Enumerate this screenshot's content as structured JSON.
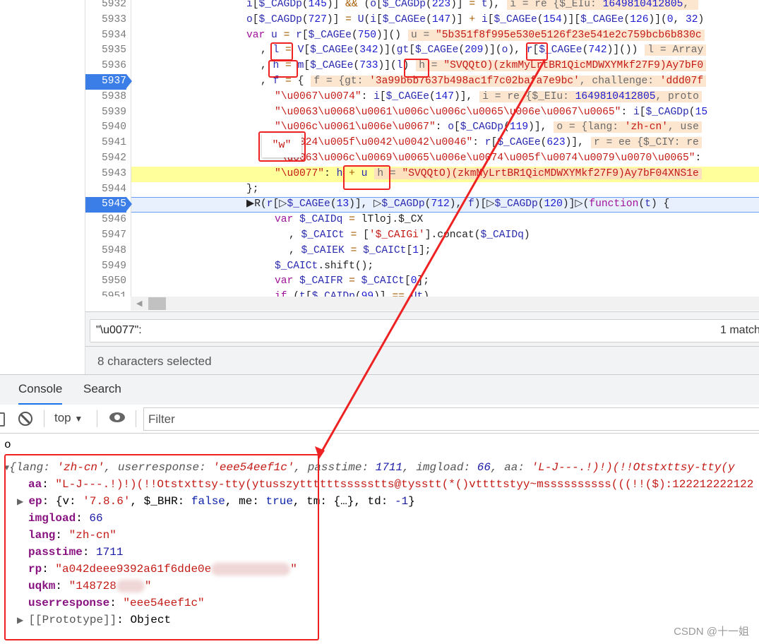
{
  "editor": {
    "lines": [
      {
        "num": "5932",
        "indent": 0,
        "tokens": [
          [
            "n",
            "i"
          ],
          [
            "p",
            "["
          ],
          [
            "n",
            "$_CAGDp"
          ],
          [
            "p",
            "("
          ],
          [
            "num",
            "145"
          ],
          [
            "p",
            ")] "
          ],
          [
            "o",
            "&&"
          ],
          [
            "p",
            " ("
          ],
          [
            "n",
            "o"
          ],
          [
            "p",
            "["
          ],
          [
            "n",
            "$_CAGDp"
          ],
          [
            "p",
            "("
          ],
          [
            "num",
            "223"
          ],
          [
            "p",
            ")] "
          ],
          [
            "o",
            "="
          ],
          [
            "p",
            " "
          ],
          [
            "n",
            "t"
          ],
          [
            "p",
            "),"
          ]
        ],
        "inline": [
          [
            "g",
            "i = re {$_EIu: "
          ],
          [
            "num",
            "1649810412805"
          ],
          [
            "g",
            ", "
          ]
        ]
      },
      {
        "num": "5933",
        "indent": 0,
        "tokens": [
          [
            "n",
            "o"
          ],
          [
            "p",
            "["
          ],
          [
            "n",
            "$_CAGDp"
          ],
          [
            "p",
            "("
          ],
          [
            "num",
            "727"
          ],
          [
            "p",
            ")] "
          ],
          [
            "o",
            "="
          ],
          [
            "p",
            " "
          ],
          [
            "n",
            "U"
          ],
          [
            "p",
            "("
          ],
          [
            "n",
            "i"
          ],
          [
            "p",
            "["
          ],
          [
            "n",
            "$_CAGEe"
          ],
          [
            "p",
            "("
          ],
          [
            "num",
            "147"
          ],
          [
            "p",
            ")] "
          ],
          [
            "o",
            "+"
          ],
          [
            "p",
            " "
          ],
          [
            "n",
            "i"
          ],
          [
            "p",
            "["
          ],
          [
            "n",
            "$_CAGEe"
          ],
          [
            "p",
            "("
          ],
          [
            "num",
            "154"
          ],
          [
            "p",
            ")]["
          ],
          [
            "n",
            "$_CAGEe"
          ],
          [
            "p",
            "("
          ],
          [
            "num",
            "126"
          ],
          [
            "p",
            ")]("
          ],
          [
            "num",
            "0"
          ],
          [
            "p",
            ", "
          ],
          [
            "num",
            "32"
          ],
          [
            "p",
            ")"
          ]
        ]
      },
      {
        "num": "5934",
        "indent": 0,
        "tokens": [
          [
            "k",
            "var "
          ],
          [
            "n",
            "u"
          ],
          [
            "p",
            " "
          ],
          [
            "o",
            "="
          ],
          [
            "p",
            " "
          ],
          [
            "n",
            "r"
          ],
          [
            "p",
            "["
          ],
          [
            "n",
            "$_CAGEe"
          ],
          [
            "p",
            "("
          ],
          [
            "num",
            "750"
          ],
          [
            "p",
            ")]()"
          ]
        ],
        "inline": [
          [
            "g",
            "u = "
          ],
          [
            "s",
            "\"5b351f8f995e530e5126f23e541e2c759bcb6b830c"
          ]
        ]
      },
      {
        "num": "5935",
        "indent": 1,
        "tokens": [
          [
            "p",
            ", "
          ],
          [
            "n",
            "l"
          ],
          [
            "p",
            " "
          ],
          [
            "o",
            "="
          ],
          [
            "p",
            " "
          ],
          [
            "n",
            "V"
          ],
          [
            "p",
            "["
          ],
          [
            "n",
            "$_CAGEe"
          ],
          [
            "p",
            "("
          ],
          [
            "num",
            "342"
          ],
          [
            "p",
            ")]("
          ],
          [
            "n",
            "gt"
          ],
          [
            "p",
            "["
          ],
          [
            "n",
            "$_CAGEe"
          ],
          [
            "p",
            "("
          ],
          [
            "num",
            "209"
          ],
          [
            "p",
            ")]("
          ],
          [
            "n",
            "o"
          ],
          [
            "p",
            "), "
          ],
          [
            "n",
            "r"
          ],
          [
            "p",
            "["
          ],
          [
            "n",
            "$_CAGEe"
          ],
          [
            "p",
            "("
          ],
          [
            "num",
            "742"
          ],
          [
            "p",
            ")]())"
          ]
        ],
        "inline": [
          [
            "g",
            "l = Array"
          ]
        ]
      },
      {
        "num": "5936",
        "indent": 1,
        "tokens": [
          [
            "p",
            ", "
          ],
          [
            "n",
            "h"
          ],
          [
            "p",
            " "
          ],
          [
            "o",
            "="
          ],
          [
            "p",
            " "
          ],
          [
            "n",
            "m"
          ],
          [
            "p",
            "["
          ],
          [
            "n",
            "$_CAGEe"
          ],
          [
            "p",
            "("
          ],
          [
            "num",
            "733"
          ],
          [
            "p",
            ")]("
          ],
          [
            "n",
            "l"
          ],
          [
            "p",
            ")"
          ]
        ],
        "inline": [
          [
            "g",
            "h = "
          ],
          [
            "s",
            "\"SVQQtO)(zkmMyLrtBR1QicMDWXYMkf27F9)Ay7bF0"
          ]
        ]
      },
      {
        "num": "5937",
        "indent": 1,
        "marker": "breakpoint",
        "tokens": [
          [
            "p",
            ", "
          ],
          [
            "n",
            "f"
          ],
          [
            "p",
            " "
          ],
          [
            "o",
            "="
          ],
          [
            "p",
            " {"
          ]
        ],
        "inline": [
          [
            "g",
            "f = {gt: "
          ],
          [
            "s",
            "'3a99b6b7637b498ac1f7c02bafa7e9bc'"
          ],
          [
            "g",
            ", challenge: "
          ],
          [
            "s",
            "'ddd07f"
          ]
        ]
      },
      {
        "num": "5938",
        "indent": 2,
        "tokens": [
          [
            "s",
            "\"\\u0067\\u0074\""
          ],
          [
            "p",
            ": "
          ],
          [
            "n",
            "i"
          ],
          [
            "p",
            "["
          ],
          [
            "n",
            "$_CAGEe"
          ],
          [
            "p",
            "("
          ],
          [
            "num",
            "147"
          ],
          [
            "p",
            ")],"
          ]
        ],
        "inline": [
          [
            "g",
            "i = re {$_EIu: "
          ],
          [
            "num",
            "1649810412805"
          ],
          [
            "g",
            ", proto"
          ]
        ]
      },
      {
        "num": "5939",
        "indent": 2,
        "tokens": [
          [
            "s",
            "\"\\u0063\\u0068\\u0061\\u006c\\u006c\\u0065\\u006e\\u0067\\u0065\""
          ],
          [
            "p",
            ": "
          ],
          [
            "n",
            "i"
          ],
          [
            "p",
            "["
          ],
          [
            "n",
            "$_CAGDp"
          ],
          [
            "p",
            "("
          ],
          [
            "num",
            "15"
          ]
        ]
      },
      {
        "num": "5940",
        "indent": 2,
        "tokens": [
          [
            "s",
            "\"\\u006c\\u0061\\u006e\\u0067\""
          ],
          [
            "p",
            ": "
          ],
          [
            "n",
            "o"
          ],
          [
            "p",
            "["
          ],
          [
            "n",
            "$_CAGDp"
          ],
          [
            "p",
            "("
          ],
          [
            "num",
            "119"
          ],
          [
            "p",
            ")],"
          ]
        ],
        "inline": [
          [
            "g",
            "o = {lang: "
          ],
          [
            "s",
            "'zh-cn'"
          ],
          [
            "g",
            ", use"
          ]
        ]
      },
      {
        "num": "5941",
        "indent": 2,
        "tokens": [
          [
            "s",
            "\"\\u0024\\u005f\\u0042\\u0042\\u0046\""
          ],
          [
            "p",
            ": "
          ],
          [
            "n",
            "r"
          ],
          [
            "p",
            "["
          ],
          [
            "n",
            "$_CAGEe"
          ],
          [
            "p",
            "("
          ],
          [
            "num",
            "623"
          ],
          [
            "p",
            ")],"
          ]
        ],
        "inline": [
          [
            "g",
            "r = ee {$_CIY: re"
          ]
        ]
      },
      {
        "num": "5942",
        "indent": 2,
        "tokens": [
          [
            "s",
            "\"\\u0063\\u006c\\u0069\\u0065\\u006e\\u0074\\u005f\\u0074\\u0079\\u0070\\u0065\""
          ],
          [
            "p",
            ":"
          ]
        ]
      },
      {
        "num": "5943",
        "indent": 2,
        "highlight": "yellow",
        "tokens": [
          [
            "s",
            "\"\\u0077\""
          ],
          [
            "p",
            ": "
          ],
          [
            "n",
            "h"
          ],
          [
            "p",
            " "
          ],
          [
            "o",
            "+"
          ],
          [
            "p",
            " "
          ],
          [
            "n",
            "u"
          ]
        ],
        "inline": [
          [
            "g",
            "h = "
          ],
          [
            "s",
            "\"SVQQtO)(zkmMyLrtBR1QicMDWXYMkf27F9)Ay7bF04XNS1e"
          ]
        ]
      },
      {
        "num": "5944",
        "indent": 0,
        "tokens": [
          [
            "p",
            "};"
          ]
        ]
      },
      {
        "num": "5945",
        "indent": 0,
        "marker": "breakpoint",
        "highlight": "current",
        "tokens": [
          [
            "p",
            "▶R("
          ],
          [
            "n",
            "r"
          ],
          [
            "p",
            "[▷"
          ],
          [
            "n",
            "$_CAGEe"
          ],
          [
            "p",
            "("
          ],
          [
            "num",
            "13"
          ],
          [
            "p",
            ")], ▷"
          ],
          [
            "n",
            "$_CAGDp"
          ],
          [
            "p",
            "("
          ],
          [
            "num",
            "712"
          ],
          [
            "p",
            "), "
          ],
          [
            "n",
            "f"
          ],
          [
            "p",
            ")[▷"
          ],
          [
            "n",
            "$_CAGDp"
          ],
          [
            "p",
            "("
          ],
          [
            "num",
            "120"
          ],
          [
            "p",
            ")]▷("
          ],
          [
            "k",
            "function"
          ],
          [
            "p",
            "("
          ],
          [
            "n",
            "t"
          ],
          [
            "p",
            ") {"
          ]
        ]
      },
      {
        "num": "5946",
        "indent": 2,
        "tokens": [
          [
            "k",
            "var "
          ],
          [
            "n",
            "$_CAIDq"
          ],
          [
            "p",
            " "
          ],
          [
            "o",
            "="
          ],
          [
            "p",
            " lTloj.$_CX"
          ]
        ]
      },
      {
        "num": "5947",
        "indent": 3,
        "tokens": [
          [
            "p",
            ", "
          ],
          [
            "n",
            "$_CAICt"
          ],
          [
            "p",
            " "
          ],
          [
            "o",
            "="
          ],
          [
            "p",
            " ["
          ],
          [
            "s",
            "'$_CAIGi'"
          ],
          [
            "p",
            "].concat("
          ],
          [
            "n",
            "$_CAIDq"
          ],
          [
            "p",
            ")"
          ]
        ]
      },
      {
        "num": "5948",
        "indent": 3,
        "tokens": [
          [
            "p",
            ", "
          ],
          [
            "n",
            "$_CAIEK"
          ],
          [
            "p",
            " "
          ],
          [
            "o",
            "="
          ],
          [
            "p",
            " "
          ],
          [
            "n",
            "$_CAICt"
          ],
          [
            "p",
            "["
          ],
          [
            "num",
            "1"
          ],
          [
            "p",
            "];"
          ]
        ]
      },
      {
        "num": "5949",
        "indent": 2,
        "tokens": [
          [
            "n",
            "$_CAICt"
          ],
          [
            "p",
            ".shift();"
          ]
        ]
      },
      {
        "num": "5950",
        "indent": 2,
        "tokens": [
          [
            "k",
            "var "
          ],
          [
            "n",
            "$_CAIFR"
          ],
          [
            "p",
            " "
          ],
          [
            "o",
            "="
          ],
          [
            "p",
            " "
          ],
          [
            "n",
            "$_CAICt"
          ],
          [
            "p",
            "["
          ],
          [
            "num",
            "0"
          ],
          [
            "p",
            "];"
          ]
        ]
      },
      {
        "num": "5951",
        "indent": 2,
        "tokens": [
          [
            "k",
            "if"
          ],
          [
            "p",
            " ("
          ],
          [
            "n",
            "t"
          ],
          [
            "p",
            "["
          ],
          [
            "n",
            "$_CAIDp"
          ],
          [
            "p",
            "("
          ],
          [
            "num",
            "99"
          ],
          [
            "p",
            ")] "
          ],
          [
            "o",
            "=="
          ],
          [
            "p",
            " "
          ],
          [
            "n",
            "Ut"
          ],
          [
            "p",
            ")"
          ]
        ]
      }
    ],
    "tooltip_value": "\"w\""
  },
  "search": {
    "query": "\"\\u0077\":",
    "matches": "1 match"
  },
  "status": {
    "text": "8 characters selected"
  },
  "tabs": [
    {
      "label": "Console",
      "active": true
    },
    {
      "label": "Search",
      "active": false
    }
  ],
  "toolbar": {
    "context": "top",
    "filter_placeholder": "Filter"
  },
  "console": {
    "input_echo": "o",
    "summary": {
      "open": "{",
      "lang_k": "lang: ",
      "lang_v": "'zh-cn'",
      "ur_k": ", userresponse: ",
      "ur_v": "'eee54eef1c'",
      "pt_k": ", passtime: ",
      "pt_v": "1711",
      "il_k": ", imgload: ",
      "il_v": "66",
      "aa_k": ", aa: ",
      "aa_v": "'L-J---.!)!)(!!Otstxttsy-tty(y"
    },
    "props": {
      "aa_k": "aa",
      "aa_v": "\"L-J---.!)!)(!!Otstxttsy-tty(ytusszyttttttssssstts@tysstt(*()vttttstyy~mssssssssss(((!!($):122212222122",
      "ep_k": "ep",
      "ep_v1": "{v: ",
      "ep_v2": "'7.8.6'",
      "ep_v3": ", $_BHR: ",
      "ep_v4": "false",
      "ep_v5": ", me: ",
      "ep_v6": "true",
      "ep_v7": ", tm: {…}, td: ",
      "ep_v8": "-1",
      "ep_v9": "}",
      "imgload_k": "imgload",
      "imgload_v": "66",
      "lang_k": "lang",
      "lang_v": "\"zh-cn\"",
      "passtime_k": "passtime",
      "passtime_v": "1711",
      "rp_k": "rp",
      "rp_v": "\"a042deee9392a61f6dde0e",
      "rp_tail": "\"",
      "uqkm_k": "uqkm",
      "uqkm_v": "\"148728",
      "uqkm_tail": "\"",
      "userresponse_k": "userresponse",
      "userresponse_v": "\"eee54eef1c\"",
      "proto_k": "[[Prototype]]",
      "proto_v": "Object"
    }
  },
  "watermark": "CSDN @十一姐",
  "colors": {
    "annotation": "#ee2222",
    "accent": "#1a73e8",
    "breakpoint": "#3b7ee8"
  }
}
